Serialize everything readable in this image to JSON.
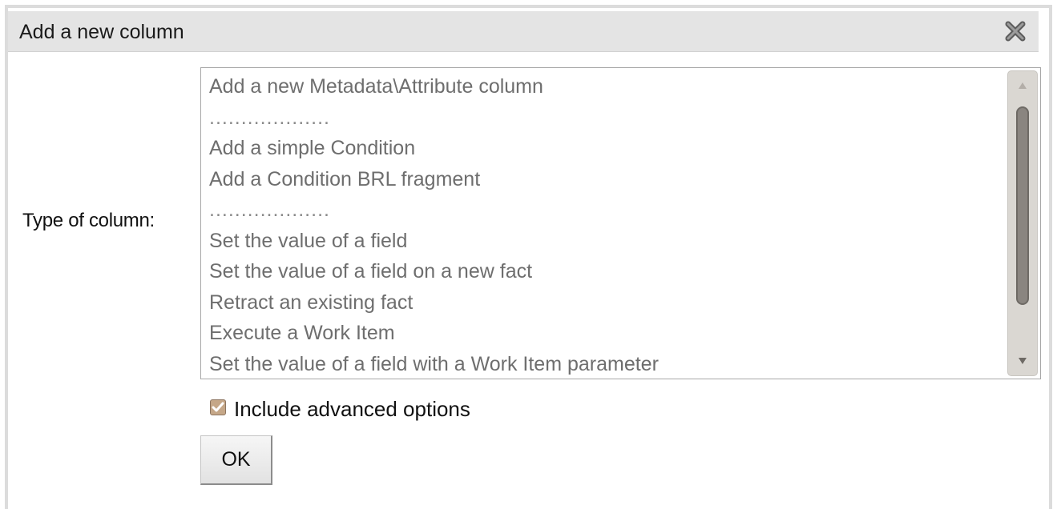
{
  "dialog": {
    "title": "Add a new column",
    "close_icon": "close-x-icon"
  },
  "form": {
    "type_label": "Type of column:",
    "column_types": [
      {
        "label": "Add a new Metadata\\Attribute column",
        "separator": false
      },
      {
        "label": "...................",
        "separator": true
      },
      {
        "label": "Add a simple Condition",
        "separator": false
      },
      {
        "label": "Add a Condition BRL fragment",
        "separator": false
      },
      {
        "label": "...................",
        "separator": true
      },
      {
        "label": "Set the value of a field",
        "separator": false
      },
      {
        "label": "Set the value of a field on a new fact",
        "separator": false
      },
      {
        "label": "Retract an existing fact",
        "separator": false
      },
      {
        "label": "Execute a Work Item",
        "separator": false
      },
      {
        "label": "Set the value of a field with a Work Item parameter",
        "separator": false
      }
    ],
    "advanced_options_label": "Include advanced options",
    "advanced_options_checked": true,
    "ok_label": "OK"
  },
  "colors": {
    "titlebar_bg": "#e4e4e4",
    "list_text": "#6e6e6e",
    "checkbox_fill": "#c5a788"
  }
}
